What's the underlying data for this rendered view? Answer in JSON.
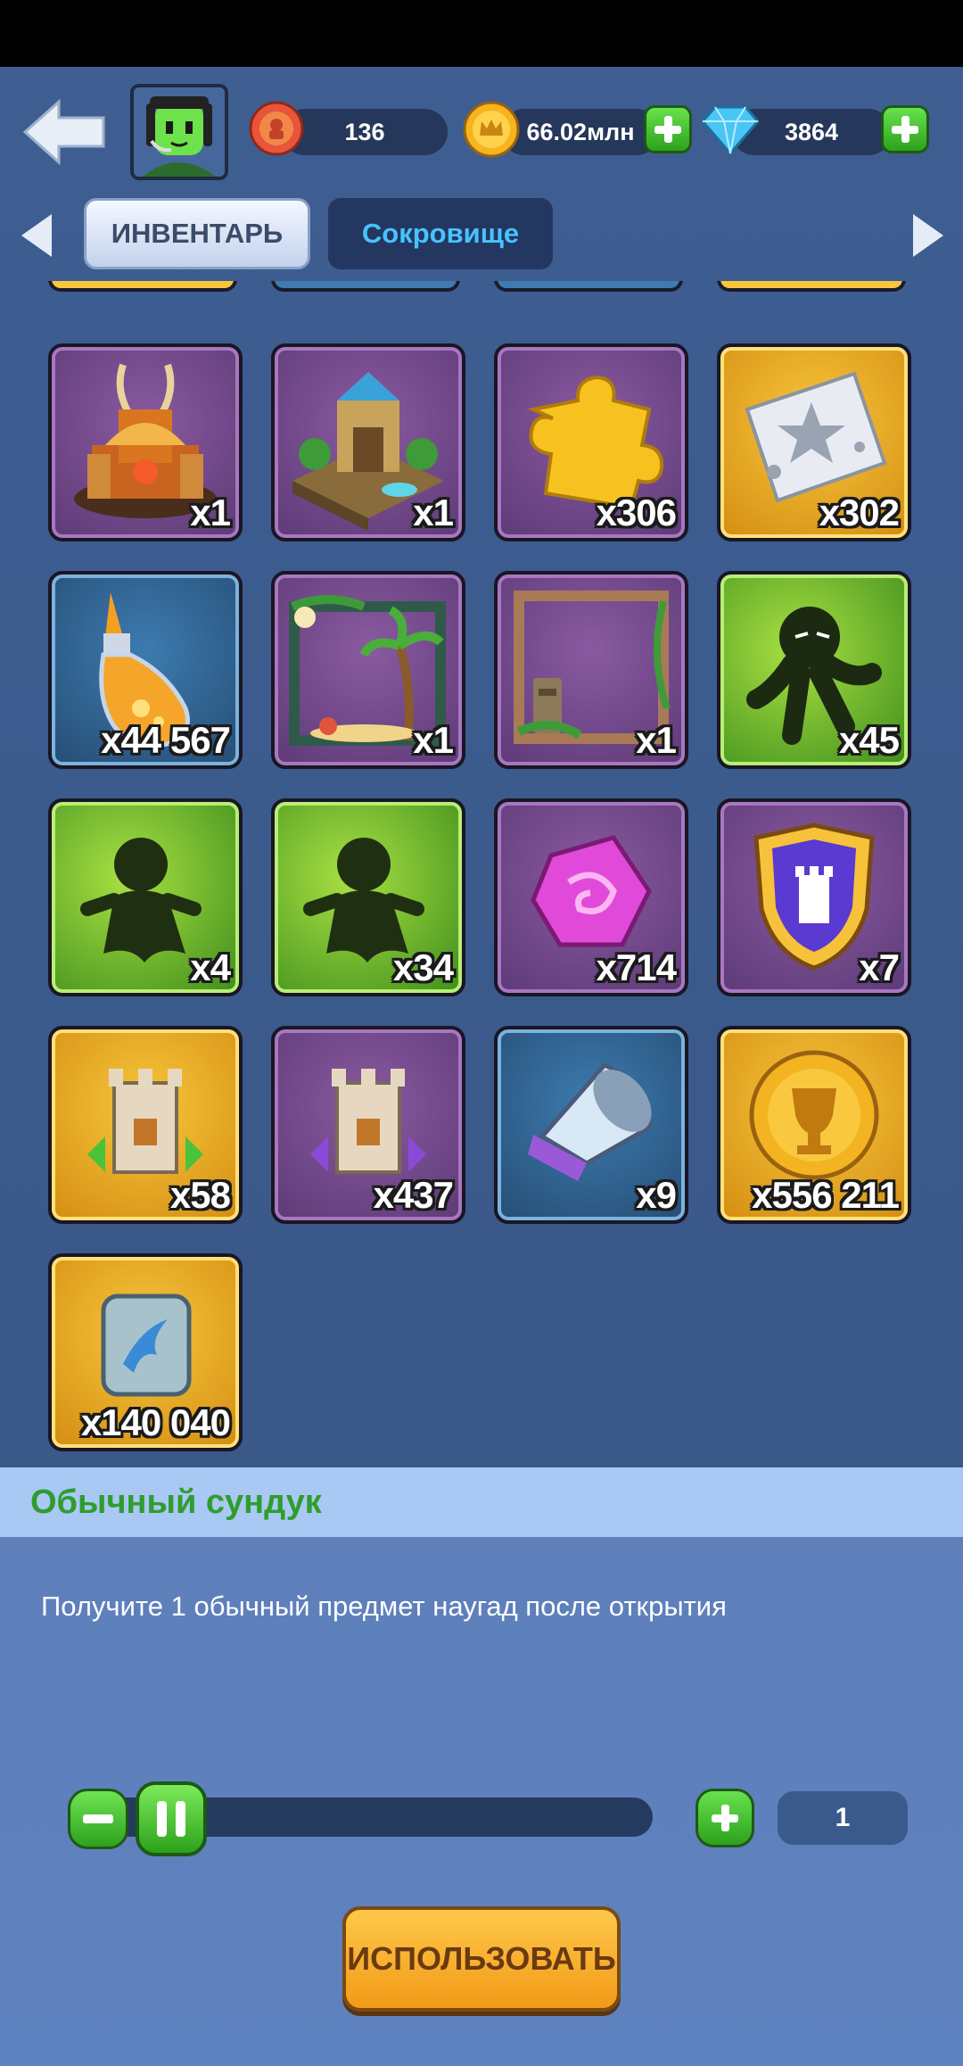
{
  "header": {
    "medal_count": "136",
    "gold_amount": "66.02млн",
    "gem_amount": "3864"
  },
  "tabs": [
    {
      "label": "ИНВЕНТАРЬ",
      "active": true
    },
    {
      "label": "Сокровище",
      "active": false
    }
  ],
  "items": [
    {
      "icon": "fire-castle-icon",
      "qty": "x1",
      "rarity": "purple"
    },
    {
      "icon": "temple-island-icon",
      "qty": "x1",
      "rarity": "purple"
    },
    {
      "icon": "puzzle-piece-icon",
      "qty": "x306",
      "rarity": "purple"
    },
    {
      "icon": "star-ticket-icon",
      "qty": "x302",
      "rarity": "gold"
    },
    {
      "icon": "potion-bottle-icon",
      "qty": "x44 567",
      "rarity": "blue"
    },
    {
      "icon": "beach-frame-icon",
      "qty": "x1",
      "rarity": "purple"
    },
    {
      "icon": "jungle-frame-icon",
      "qty": "x1",
      "rarity": "purple"
    },
    {
      "icon": "shadow-runner-icon",
      "qty": "x45",
      "rarity": "green"
    },
    {
      "icon": "silhouette-icon",
      "qty": "x4",
      "rarity": "green"
    },
    {
      "icon": "silhouette-icon",
      "qty": "x34",
      "rarity": "green"
    },
    {
      "icon": "pink-gem-icon",
      "qty": "x714",
      "rarity": "purple"
    },
    {
      "icon": "tower-shield-icon",
      "qty": "x7",
      "rarity": "purple"
    },
    {
      "icon": "green-tower-upgrade-icon",
      "qty": "x58",
      "rarity": "gold"
    },
    {
      "icon": "purple-tower-upgrade-icon",
      "qty": "x437",
      "rarity": "purple"
    },
    {
      "icon": "megaphone-icon",
      "qty": "x9",
      "rarity": "blue"
    },
    {
      "icon": "trophy-coin-icon",
      "qty": "x556 211",
      "rarity": "gold"
    },
    {
      "icon": "stone-tablet-icon",
      "qty": "x140 040",
      "rarity": "gold"
    }
  ],
  "detail": {
    "title": "Обычный сундук",
    "description": "Получите 1 обычный предмет наугад после открытия",
    "quantity": "1",
    "use_label": "ИСПОЛЬЗОВАТЬ"
  },
  "colors": {
    "background": "#3b5a8e",
    "accent_green": "#2ea11e",
    "title_green": "#2f9d2d",
    "use_button": "#f29a17"
  }
}
